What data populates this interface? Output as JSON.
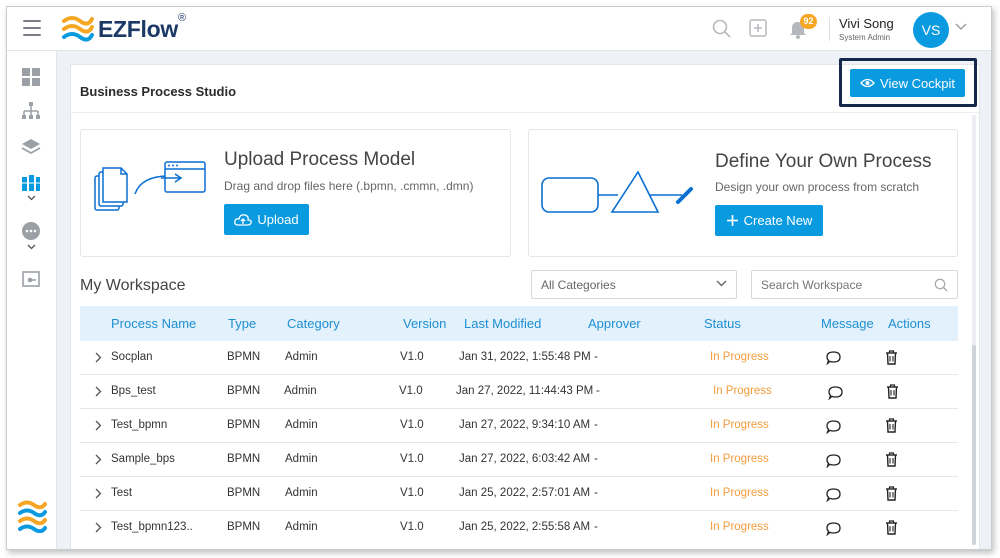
{
  "app": {
    "logo_name": "EZFlow",
    "logo_mark": "®",
    "notification_count": "92",
    "user_name": "Vivi Song",
    "user_role": "System Admin",
    "user_initials": "VS"
  },
  "panel": {
    "title": "Business Process Studio",
    "view_cockpit_label": "View Cockpit"
  },
  "upload_card": {
    "title": "Upload Process Model",
    "subtitle": "Drag and drop files here (.bpmn, .cmmn, .dmn)",
    "button_label": "Upload"
  },
  "define_card": {
    "title": "Define Your Own Process",
    "subtitle": "Design your own process from scratch",
    "button_label": "Create New"
  },
  "workspace": {
    "title": "My Workspace",
    "category_select": "All Categories",
    "search_placeholder": "Search Workspace",
    "columns": [
      "Process Name",
      "Type",
      "Category",
      "Version",
      "Last Modified",
      "Approver",
      "Status",
      "Message",
      "Actions"
    ],
    "rows": [
      {
        "name": "Socplan",
        "type": "BPMN",
        "category": "Admin",
        "version": "V1.0",
        "modified": "Jan 31, 2022, 1:55:48 PM",
        "approver": "-",
        "status": "In Progress"
      },
      {
        "name": "Bps_test",
        "type": "BPMN",
        "category": "Admin",
        "version": "V1.0",
        "modified": "Jan 27, 2022, 11:44:43 PM",
        "approver": "-",
        "status": "In Progress"
      },
      {
        "name": "Test_bpmn",
        "type": "BPMN",
        "category": "Admin",
        "version": "V1.0",
        "modified": "Jan 27, 2022, 9:34:10 AM",
        "approver": "-",
        "status": "In Progress"
      },
      {
        "name": "Sample_bps",
        "type": "BPMN",
        "category": "Admin",
        "version": "V1.0",
        "modified": "Jan 27, 2022, 6:03:42 AM",
        "approver": "-",
        "status": "In Progress"
      },
      {
        "name": "Test",
        "type": "BPMN",
        "category": "Admin",
        "version": "V1.0",
        "modified": "Jan 25, 2022, 2:57:01 AM",
        "approver": "-",
        "status": "In Progress"
      },
      {
        "name": "Test_bpmn123..",
        "type": "BPMN",
        "category": "Admin",
        "version": "V1.0",
        "modified": "Jan 25, 2022, 2:55:58 AM",
        "approver": "-",
        "status": "In Progress"
      }
    ]
  },
  "colors": {
    "accent": "#0a9ae0",
    "status_in_progress": "#f39c3c",
    "header_row": "#e2f1fb",
    "brand_navy": "#1c3966"
  }
}
